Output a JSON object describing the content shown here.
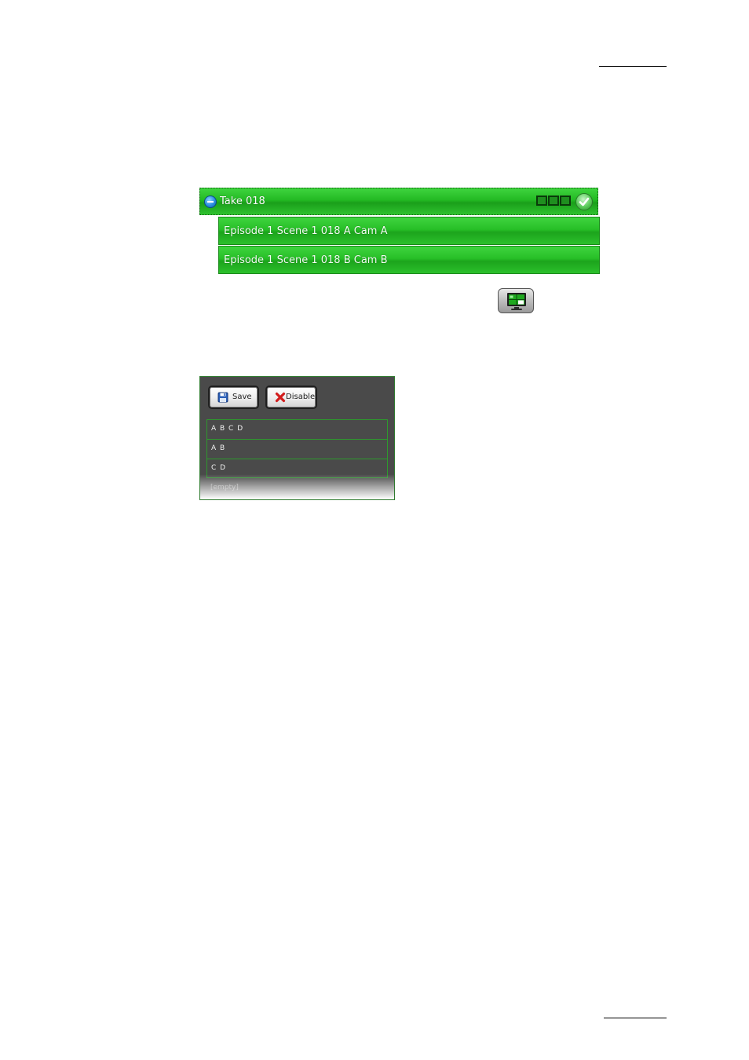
{
  "take_tree": {
    "take": {
      "title": "Take 018",
      "collapse_icon": "minus-circle-icon",
      "status_icon": "check-circle-icon",
      "status_box_count": 3
    },
    "clips": [
      {
        "label": "Episode 1 Scene 1 018 A Cam A"
      },
      {
        "label": "Episode 1 Scene 1 018 B Cam B"
      }
    ]
  },
  "toolbar": {
    "monitor_icon": "multiviewer-monitor-icon"
  },
  "layout_panel": {
    "save_label": "Save",
    "disable_label": "Disable",
    "save_icon": "floppy-disk-icon",
    "disable_icon": "red-x-icon",
    "rows": [
      {
        "label": "A B C D"
      },
      {
        "label": "A B"
      },
      {
        "label": "C D"
      }
    ],
    "empty_label": "[empty]"
  },
  "colors": {
    "row_green": "#27bf27",
    "panel_bg": "#4a4a4a",
    "grid_green": "#2d9a2d"
  }
}
